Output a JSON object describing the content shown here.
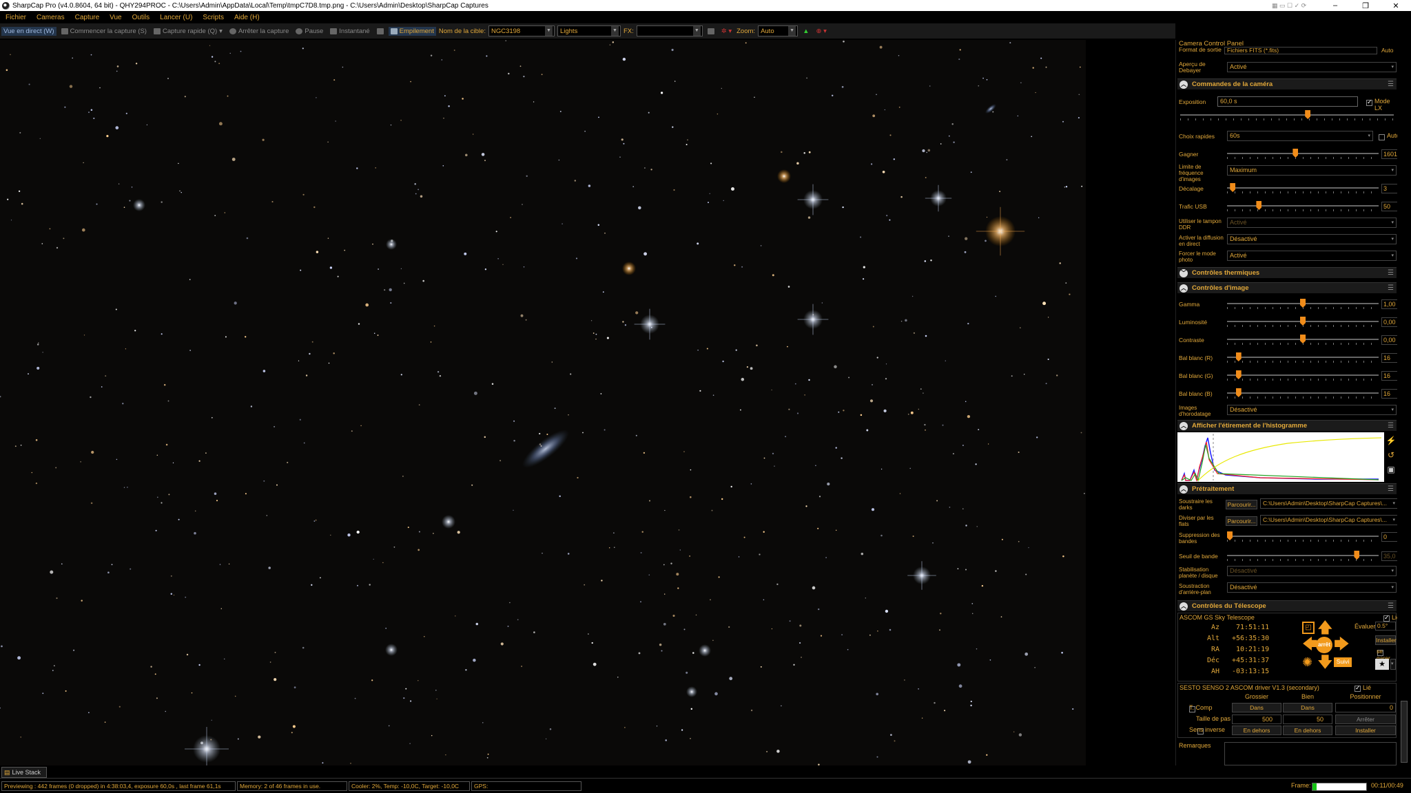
{
  "window": {
    "title": "SharpCap Pro (v4.0.8604, 64 bit) - QHY294PROC - C:\\Users\\Admin\\AppData\\Local\\Temp\\tmpC7D8.tmp.png - C:\\Users\\Admin\\Desktop\\SharpCap Captures",
    "minimize": "–",
    "maximize": "❐",
    "close": "✕"
  },
  "menu": [
    "Fichier",
    "Cameras",
    "Capture",
    "Vue",
    "Outils",
    "Lancer (U)",
    "Scripts",
    "Aide (H)"
  ],
  "toolbar": {
    "live_view": "Vue en direct (W)",
    "start_capture": "Commencer la capture (S)",
    "quick_capture": "Capture rapide (Q)",
    "stop_capture": "Arrêter la capture",
    "pause": "Pause",
    "snapshot": "Instantané",
    "stacking": "Empilement",
    "target_label": "Nom de la cible:",
    "target_value": "NGC3198",
    "frame_type": "Lights",
    "fx_label": "FX:",
    "fx_value": "",
    "zoom_label": "Zoom:",
    "zoom_value": "Auto"
  },
  "panel": {
    "title": "Camera Control Panel",
    "output_format_label": "Format de sortie",
    "output_format_value": "Fichiers FITS (*.fits)",
    "output_auto": "Auto",
    "debayer_label": "Aperçu de Debayer",
    "debayer_value": "Activé",
    "camera_section": "Commandes de la caméra",
    "exposure_label": "Exposition",
    "exposure_value": "60,0 s",
    "lx_mode": "Mode LX",
    "quick_choice_label": "Choix rapides",
    "quick_choice_value": "60s",
    "quick_auto": "Auto",
    "gain_label": "Gagner",
    "gain_value": "1601",
    "frame_limit_label": "Limite de fréquence d'images",
    "frame_limit_value": "Maximum",
    "offset_label": "Décalage",
    "offset_value": "3",
    "usb_label": "Trafic USB",
    "usb_value": "50",
    "ddr_label": "Utiliser le tampon DDR",
    "ddr_value": "Activé",
    "live_stream_label": "Activer la diffusion en direct",
    "live_stream_value": "Désactivé",
    "photo_mode_label": "Forcer le mode photo",
    "photo_mode_value": "Activé",
    "thermal_section": "Contrôles thermiques",
    "image_section": "Contrôles d'image",
    "gamma_label": "Gamma",
    "gamma_value": "1,00",
    "brightness_label": "Luminosité",
    "brightness_value": "0,00",
    "contrast_label": "Contraste",
    "contrast_value": "0,00",
    "wbr_label": "Bal blanc (R)",
    "wbr_value": "16",
    "wbg_label": "Bal blanc (G)",
    "wbg_value": "16",
    "wbb_label": "Bal blanc (B)",
    "wbb_value": "16",
    "timestamp_label": "Images d'horodatage",
    "timestamp_value": "Désactivé",
    "histogram_section": "Afficher l'étirement de l'histogramme",
    "preprocessing_section": "Prétraitement",
    "darks_label": "Soustraire les darks",
    "flats_label": "Diviser par les flats",
    "browse": "Parcourir...",
    "darks_path": "C:\\Users\\Admin\\Desktop\\SharpCap Captures\\...",
    "flats_path": "C:\\Users\\Admin\\Desktop\\SharpCap Captures\\...",
    "banding_label": "Suppression des bandes",
    "banding_value": "0",
    "band_threshold_label": "Seuil de bande",
    "band_threshold_value": "35,0",
    "stabilisation_label": "Stabilisation planète / disque",
    "stabilisation_value": "Désactivé",
    "bg_sub_label": "Soustraction d'arrière-plan",
    "bg_sub_value": "Désactivé",
    "telescope_section": "Contrôles du Télescope",
    "telescope_name": "ASCOM GS Sky Telescope",
    "linked": "Lié",
    "az_label": "Az",
    "az": "71:51:11",
    "alt_label": "Alt",
    "alt": "+56:35:30",
    "ra_label": "RA",
    "ra": "10:21:19",
    "dec_label": "Déc",
    "dec": "+45:31:37",
    "ah_label": "AH",
    "ah": "-03:13:15",
    "rate_label": "Évaluer",
    "rate_value": "0.5°",
    "install": "Installer",
    "park": "se garer",
    "stop_btn": "arrêt",
    "track": "Suivi",
    "focuser_name": "SESTO SENSO 2 ASCOM driver V1.3 (secondary)",
    "coarse": "Grossier",
    "fine": "Bien",
    "position": "Positionner",
    "tcomp": "T. Comp",
    "in": "Dans",
    "position_value": "0",
    "step_label": "Taille de pas",
    "step_coarse": "500",
    "step_fine": "50",
    "stop": "Arrêter",
    "reverse": "Sens inverse",
    "out": "En dehors",
    "notes_label": "Remarques"
  },
  "status": {
    "live_stack_tab": "Live Stack",
    "previewing": "Previewing : 442 frames (0 dropped) in 4:38:03,4, exposure 60,0s , last frame 61,1s",
    "memory": "Memory: 2 of 46 frames in use.",
    "cooler": "Cooler: 2%, Temp: -10,0C, Target: -10,0C",
    "gps": "GPS:",
    "frame_label": "Frame:",
    "frame_time": "00:11/00:49",
    "frame_progress": 0.08
  },
  "colors": {
    "accent": "#e3a93a",
    "thumb": "#f08c1a",
    "nav_arrow": "#f29a1c"
  },
  "sliders": {
    "exposure": 0.6,
    "gain": 0.45,
    "offset": 0.02,
    "usb": 0.2,
    "gamma": 0.5,
    "brightness": 0.5,
    "contrast": 0.5,
    "wbr": 0.06,
    "wbg": 0.06,
    "wbb": 0.06,
    "banding": 0.0,
    "band_threshold": 0.87
  }
}
